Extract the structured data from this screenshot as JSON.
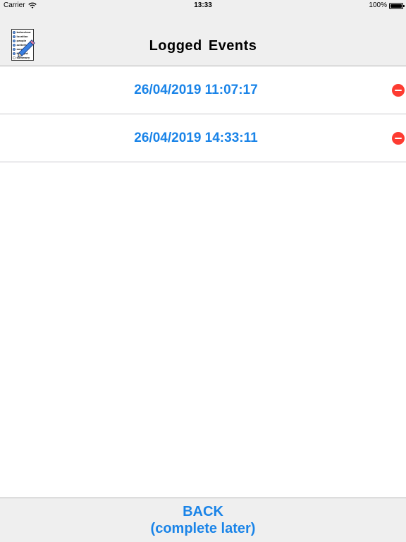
{
  "status_bar": {
    "carrier": "Carrier",
    "time": "13:33",
    "battery": "100%",
    "wifi_icon": "wifi-icon",
    "battery_icon": "battery-icon"
  },
  "nav_bar": {
    "title": "Logged  Events",
    "app_icon": "checklist-pencil-icon",
    "icon_lines": [
      "behaviour",
      "location",
      "people",
      "activity",
      "emotion",
      "thought",
      "summary"
    ]
  },
  "events": [
    {
      "label": "26/04/2019 11:07:17",
      "delete_icon": "remove-circle-icon"
    },
    {
      "label": "26/04/2019 14:33:11",
      "delete_icon": "remove-circle-icon"
    }
  ],
  "bottom_bar": {
    "back_line1": "BACK",
    "back_line2": "(complete later)"
  },
  "colors": {
    "accent": "#1a84e8",
    "bar_background": "#efefef",
    "delete": "#fd3b31"
  }
}
